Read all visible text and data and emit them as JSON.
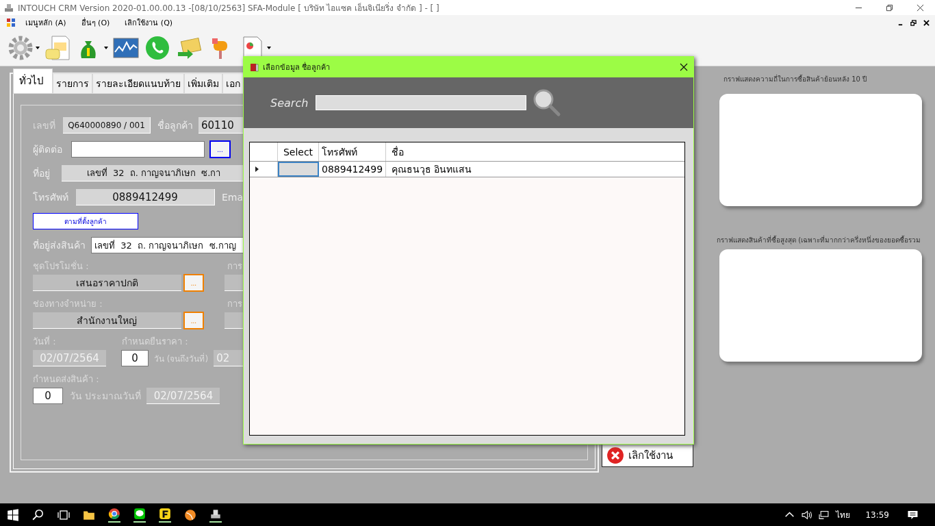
{
  "window": {
    "title": "INTOUCH CRM Version 2020-01.00.00.13 -[08/10/2563] SFA-Module  [ บริษัท ไอแซค เอ็นจิเนียริ่ง จำกัด ] - [ ]"
  },
  "menu": [
    "เมนูหลัก (A)",
    "อื่นๆ (O)",
    "เลิกใช้งาน (Q)"
  ],
  "tabs": [
    {
      "label": "ทั่วไป",
      "selected": true
    },
    {
      "label": "รายการ",
      "selected": false
    },
    {
      "label": "รายละเอียดแนบท้าย",
      "selected": false
    },
    {
      "label": "เพิ่มเติม",
      "selected": false
    },
    {
      "label": "เอก",
      "selected": false
    }
  ],
  "form": {
    "doc_no": {
      "label": "เลขที่",
      "value": "Q640000890 / 001"
    },
    "customer": {
      "label": "ชื่อลูกค้า",
      "value": "60110"
    },
    "contact": {
      "label": "ผู้ติดต่อ",
      "button": "..."
    },
    "address": {
      "label": "ที่อยู่",
      "value": "เลขที่  32  ถ. กาญจนาภิเษก  ซ.กา"
    },
    "phone": {
      "label": "โทรศัพท์",
      "value": "0889412499"
    },
    "email_label": "Ema",
    "customer_address_button": "ตามที่ตั้งลูกค้า",
    "ship_address": {
      "label": "ที่อยู่ส่งสินค้า",
      "value": "เลขที่  32  ถ. กาญจนาภิเษก  ซ.กาญ"
    },
    "promotion": {
      "label": "ชุดโปรโมชั่น :",
      "value": "เสนอราคาปกติ",
      "button": "...",
      "right_label": "การ"
    },
    "channel": {
      "label": "ช่องทางจำหน่าย  :",
      "value": "สำนักงานใหญ่",
      "button": "...",
      "right_label": "การ"
    },
    "date": {
      "label": "วันที่ :",
      "value": "02/07/2564"
    },
    "price_valid": {
      "label": "กำหนดยืนราคา :",
      "days": "0",
      "unit": "วัน (จนถึงวันที่)",
      "until": "02"
    },
    "delivery": {
      "label": "กำหนดส่งสินค้า :",
      "days": "0",
      "unit": "วัน ประมาณวันที่",
      "date": "02/07/2564"
    }
  },
  "cancel_button": "เลิกใช้งาน",
  "charts": [
    {
      "title": "กราฟแสดงความถี่ในการซื้อสินค้าย้อนหลัง 10 ปี"
    },
    {
      "title": "กราฟแสดงสินค้าที่ซื้อสูงสุด (เฉพาะที่มากกว่าครึ่งหนึ่งของยอดซื้อรวม"
    }
  ],
  "dialog": {
    "title": "เลือกข้อมูล ชื่อลูกค้า",
    "search_label": "Search",
    "columns": [
      "Select",
      "โทรศัพท์",
      "ชื่อ"
    ],
    "rows": [
      {
        "selected": true,
        "phone": "0889412499",
        "name": "คุณธนวุธ อินทแสน"
      }
    ]
  },
  "taskbar": {
    "language": "ไทย",
    "time": "13:59"
  }
}
